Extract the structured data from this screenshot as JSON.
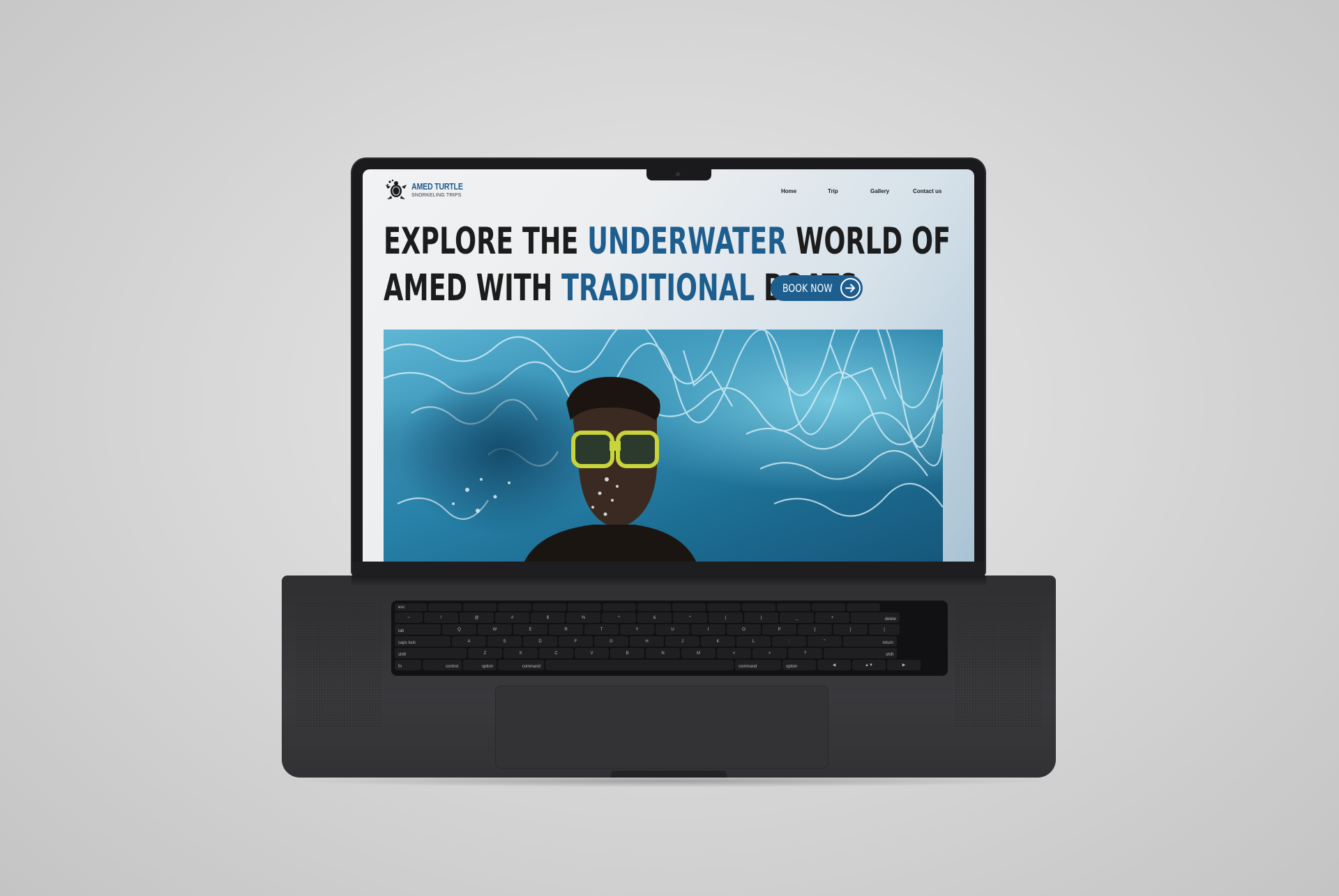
{
  "site": {
    "logo": {
      "title": "AMED TURTLE",
      "subtitle": "SNORKELING TRIPS"
    },
    "nav": {
      "items": [
        {
          "label": "Home"
        },
        {
          "label": "Trip"
        },
        {
          "label": "Gallery"
        },
        {
          "label": "Contact us"
        }
      ]
    },
    "hero": {
      "line1_part1": "EXPLORE THE ",
      "line1_accent": "UNDERWATER",
      "line1_part2": " WORLD OF",
      "line2_part1": "AMED WITH ",
      "line2_accent": "TRADITIONAL",
      "line2_part2": " BOATS",
      "cta_label": "BOOK NOW",
      "cta_icon": "arrow-right-icon",
      "image": "snorkeler-underwater-photo"
    }
  },
  "keyboard": {
    "row1": [
      "esc",
      "",
      "",
      "",
      "",
      "",
      "",
      "",
      "",
      "",
      "",
      "",
      "",
      ""
    ],
    "row2": [
      "~",
      "!",
      "@",
      "#",
      "$",
      "%",
      "^",
      "&",
      "*",
      "(",
      ")",
      "_",
      "+",
      "delete"
    ],
    "row3": [
      "tab",
      "Q",
      "W",
      "E",
      "R",
      "T",
      "Y",
      "U",
      "I",
      "O",
      "P",
      "{",
      "}",
      "|"
    ],
    "row4": [
      "caps lock",
      "A",
      "S",
      "D",
      "F",
      "G",
      "H",
      "J",
      "K",
      "L",
      ":",
      "\"",
      "return"
    ],
    "row5": [
      "shift",
      "Z",
      "X",
      "C",
      "V",
      "B",
      "N",
      "M",
      "<",
      ">",
      "?",
      "shift"
    ],
    "row6": [
      "fn",
      "control",
      "option",
      "command",
      "",
      "command",
      "option",
      "◀",
      "▲▼",
      "▶"
    ]
  },
  "colors": {
    "accent": "#1d5e8e",
    "headline": "#1c1c1c",
    "laptop_body": "#36363a"
  }
}
